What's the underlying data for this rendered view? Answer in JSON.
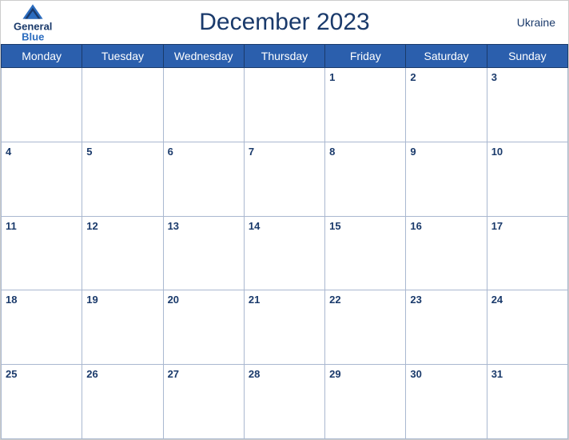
{
  "header": {
    "logo": {
      "general": "General",
      "blue": "Blue"
    },
    "title": "December 2023",
    "country": "Ukraine"
  },
  "weekdays": [
    "Monday",
    "Tuesday",
    "Wednesday",
    "Thursday",
    "Friday",
    "Saturday",
    "Sunday"
  ],
  "weeks": [
    [
      null,
      null,
      null,
      null,
      1,
      2,
      3
    ],
    [
      4,
      5,
      6,
      7,
      8,
      9,
      10
    ],
    [
      11,
      12,
      13,
      14,
      15,
      16,
      17
    ],
    [
      18,
      19,
      20,
      21,
      22,
      23,
      24
    ],
    [
      25,
      26,
      27,
      28,
      29,
      30,
      31
    ]
  ]
}
